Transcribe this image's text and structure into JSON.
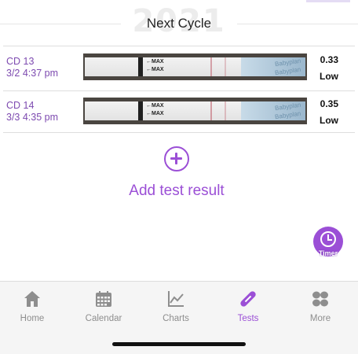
{
  "section": {
    "year": "2021",
    "title": "Next Cycle"
  },
  "tests": [
    {
      "cycle_day": "CD 13",
      "datetime": "3/2 4:37 pm",
      "strip_marks": [
        "←MAX",
        "←MAX"
      ],
      "strip_brand": [
        "Babyplan",
        "Babyplan"
      ],
      "value": "0.33",
      "level": "Low"
    },
    {
      "cycle_day": "CD 14",
      "datetime": "3/3 4:35 pm",
      "strip_marks": [
        "←MAX",
        "←MAX"
      ],
      "strip_brand": [
        "Babyplan",
        "Babyplan"
      ],
      "value": "0.35",
      "level": "Low"
    }
  ],
  "add_test": {
    "label": "Add test result",
    "icon": "plus-circle-icon"
  },
  "timer": {
    "label": "Timer",
    "icon": "clock-icon"
  },
  "tab_bar": {
    "tabs": [
      {
        "label": "Home",
        "icon": "home-icon"
      },
      {
        "label": "Calendar",
        "icon": "calendar-icon"
      },
      {
        "label": "Charts",
        "icon": "chart-line-icon"
      },
      {
        "label": "Tests",
        "icon": "test-strip-icon"
      },
      {
        "label": "More",
        "icon": "more-icon"
      }
    ],
    "active": "Tests"
  },
  "colors": {
    "accent": "#9b4fd6",
    "label": "#7d4ab0",
    "inactive": "#8e8e8e"
  }
}
